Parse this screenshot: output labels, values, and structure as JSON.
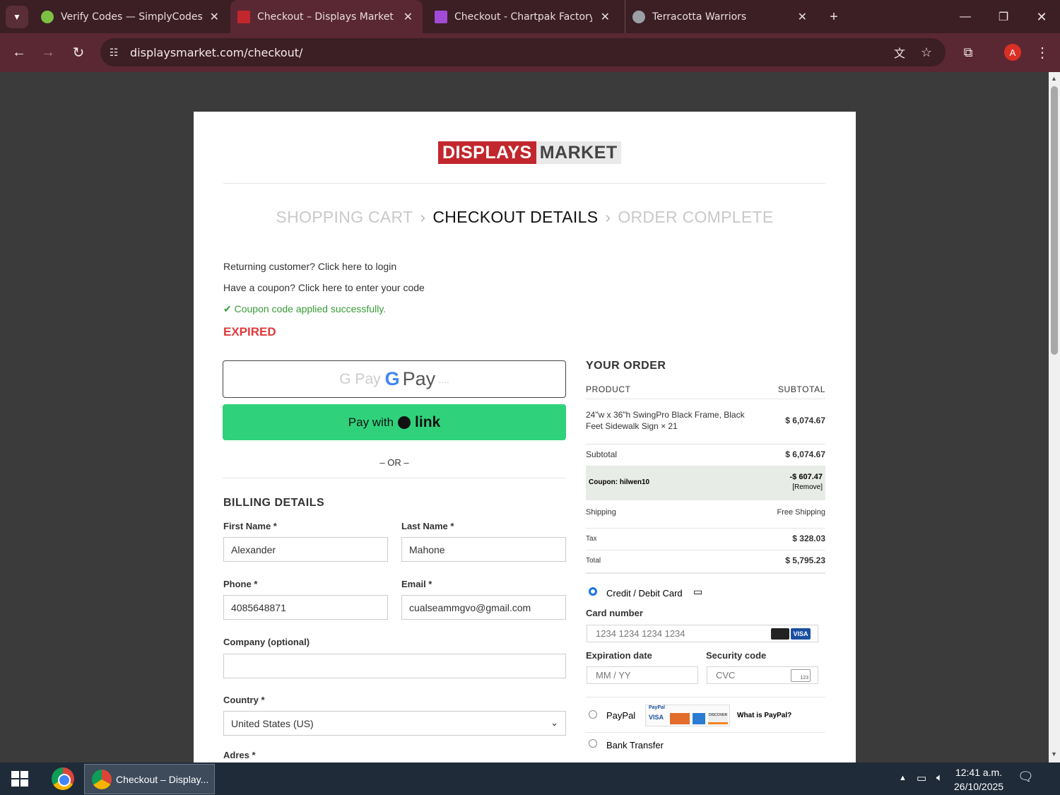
{
  "browser": {
    "tabs": [
      {
        "title": "Verify Codes — SimplyCodes",
        "fav_color": "#7cc142"
      },
      {
        "title": "Checkout – Displays Market",
        "fav_color": "#c1272d"
      },
      {
        "title": "Checkout - Chartpak Factory St",
        "fav_color": "#a24bd6"
      },
      {
        "title": "Terracotta Warriors",
        "fav_color": "#9aa0a6"
      }
    ],
    "url": "displaysmarket.com/checkout/",
    "profile_initial": "A"
  },
  "page": {
    "logo_left": "DISPLAYS",
    "logo_right": "MARKET",
    "steps": {
      "cart": "SHOPPING CART",
      "details": "CHECKOUT DETAILS",
      "complete": "ORDER COMPLETE"
    },
    "returning": "Returning customer? Click here to login",
    "coupon_prompt": "Have a coupon? Click here to enter your code",
    "coupon_applied": "Coupon code applied successfully.",
    "expired": "EXPIRED",
    "gpay_left": "G Pay",
    "gpay_mid": "G",
    "gpay_right": "Pay",
    "gpay_dots": "....",
    "link_pay": "Pay with",
    "link_word": "link",
    "or": "– OR –",
    "billing_title": "BILLING DETAILS",
    "fields": {
      "first_name_label": "First Name *",
      "first_name": "Alexander",
      "last_name_label": "Last Name *",
      "last_name": "Mahone",
      "phone_label": "Phone *",
      "phone": "4085648871",
      "email_label": "Email *",
      "email": "cualseammgvo@gmail.com",
      "company_label": "Company (optional)",
      "company": "",
      "country_label": "Country *",
      "country": "United States (US)",
      "address_label": "Adres *"
    },
    "order": {
      "title": "YOUR ORDER",
      "col_product": "PRODUCT",
      "col_subtotal": "SUBTOTAL",
      "item_name": "24\"w x 36\"h SwingPro Black Frame, Black Feet Sidewalk Sign",
      "item_qty": "× 21",
      "item_price": "$ 6,074.67",
      "subtotal_label": "Subtotal",
      "subtotal": "$ 6,074.67",
      "coupon_label": "Coupon: hilwen10",
      "coupon_amount": "-$ 607.47",
      "coupon_remove": "[Remove]",
      "shipping_label": "Shipping",
      "shipping": "Free Shipping",
      "tax_label": "Tax",
      "tax": "$ 328.03",
      "total_label": "Total",
      "total": "$ 5,795.23"
    },
    "payment": {
      "card_label": "Credit / Debit Card",
      "card_number_label": "Card number",
      "card_number_ph": "1234 1234 1234 1234",
      "exp_label": "Expiration date",
      "exp_ph": "MM / YY",
      "cvc_label": "Security code",
      "cvc_ph": "CVC",
      "cvc_icon_text": "123",
      "paypal_label": "PayPal",
      "paypal_what": "What is PayPal?",
      "paypal_logo": "PayPal",
      "visa": "VISA",
      "discover": "DISCOVER",
      "bank_label": "Bank Transfer"
    }
  },
  "taskbar": {
    "task_title": "Checkout – Display...",
    "time": "12:41 a.m.",
    "date": "26/10/2025"
  }
}
